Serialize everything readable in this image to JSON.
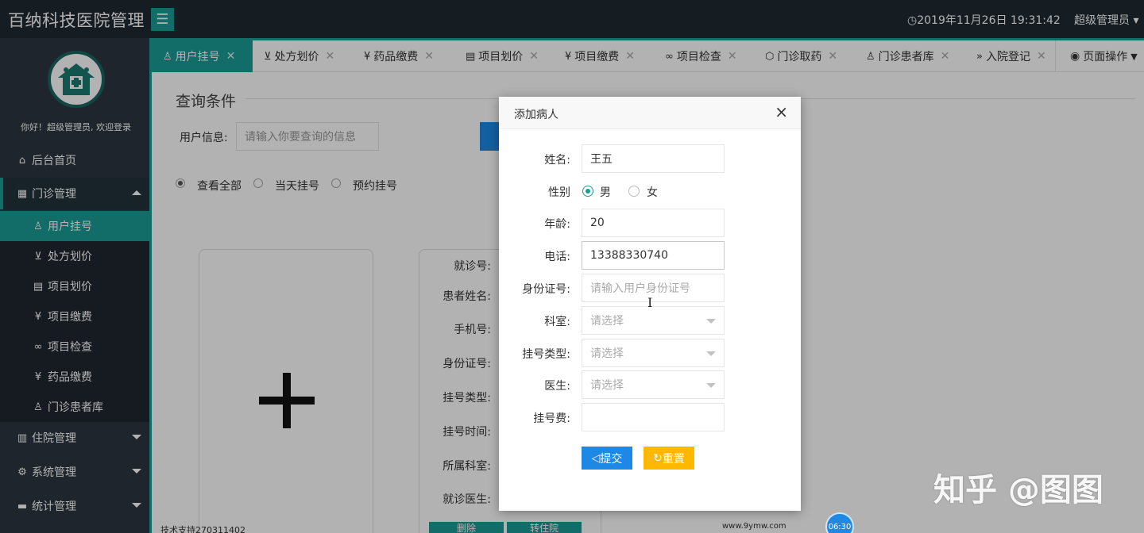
{
  "header": {
    "app_title": "百纳科技医院管理",
    "menu_icon": "☰",
    "clock": "2019年11月26日 19:31:42",
    "clock_icon": "clock-icon",
    "user": "超级管理员"
  },
  "sidebar": {
    "welcome": "你好！超级管理员, 欢迎登录",
    "items": [
      {
        "label": "后台首页",
        "icon": "⌂"
      },
      {
        "label": "门诊管理",
        "icon": "▦"
      },
      {
        "label": "住院管理",
        "icon": "▥"
      },
      {
        "label": "系统管理",
        "icon": "⚙"
      },
      {
        "label": "统计管理",
        "icon": "▬"
      }
    ],
    "sub_items": [
      {
        "label": "用户挂号",
        "icon": "♙"
      },
      {
        "label": "处方划价",
        "icon": "⊻"
      },
      {
        "label": "项目划价",
        "icon": "▤"
      },
      {
        "label": "项目缴费",
        "icon": "¥"
      },
      {
        "label": "项目检查",
        "icon": "∞"
      },
      {
        "label": "药品缴费",
        "icon": "¥"
      },
      {
        "label": "门诊患者库",
        "icon": "♙"
      }
    ]
  },
  "tabs": [
    {
      "label": "用户挂号",
      "icon": "♙"
    },
    {
      "label": "处方划价",
      "icon": "⊻"
    },
    {
      "label": "药品缴费",
      "icon": "¥"
    },
    {
      "label": "项目划价",
      "icon": "▤"
    },
    {
      "label": "项目缴费",
      "icon": "¥"
    },
    {
      "label": "项目检查",
      "icon": "∞"
    },
    {
      "label": "门诊取药",
      "icon": "⬡"
    },
    {
      "label": "门诊患者库",
      "icon": "♙"
    },
    {
      "label": "入院登记",
      "icon": "»"
    }
  ],
  "page_ops": "页面操作",
  "query": {
    "title": "查询条件",
    "user_info_label": "用户信息:",
    "user_info_placeholder": "请输入你要查询的信息",
    "radios": [
      "查看全部",
      "当天挂号",
      "预约挂号"
    ]
  },
  "info_card": {
    "labels": [
      "就诊号:",
      "患者姓名:",
      "手机号:",
      "身份证号:",
      "挂号类型:",
      "挂号时间:",
      "所属科室:",
      "就诊医生:"
    ],
    "buttons": [
      "删除",
      "转住院"
    ]
  },
  "modal": {
    "title": "添加病人",
    "close": "×",
    "name_label": "姓名:",
    "name_value": "王五",
    "gender_label": "性别",
    "gender_male": "男",
    "gender_female": "女",
    "age_label": "年龄:",
    "age_value": "20",
    "phone_label": "电话:",
    "phone_value": "13388330740",
    "id_label": "身份证号:",
    "id_placeholder": "请输入用户身份证号",
    "dept_label": "科室:",
    "dept_value": "请选择",
    "type_label": "挂号类型:",
    "type_value": "请选择",
    "doctor_label": "医生:",
    "doctor_value": "请选择",
    "fee_label": "挂号费:",
    "fee_value": "",
    "submit": "提交",
    "reset": "重置"
  },
  "footer": {
    "support": "技术支持270311402",
    "site": "www.9ymw.com",
    "video_time": "06:30"
  },
  "watermark": "知乎 @图图",
  "colors": {
    "teal": "#1a9b95",
    "blue": "#1e88e5",
    "yellow": "#ffb800",
    "dark": "#1f2a33"
  }
}
